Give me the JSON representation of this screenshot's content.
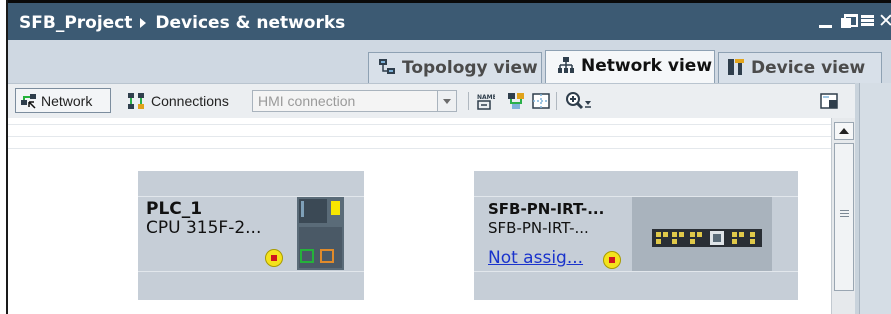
{
  "window": {
    "title_project": "SFB_Project",
    "title_section": "Devices & networks"
  },
  "tabs": [
    {
      "label": "Topology view",
      "icon": "topology-icon",
      "active": false
    },
    {
      "label": "Network view",
      "icon": "network-view-icon",
      "active": true
    },
    {
      "label": "Device view",
      "icon": "device-view-icon",
      "active": false
    }
  ],
  "toolbar": {
    "network_label": "Network",
    "connections_label": "Connections",
    "connection_type_selected": "HMI connection",
    "connection_type_placeholder": "HMI connection"
  },
  "devices": [
    {
      "name": "PLC_1",
      "type": "CPU 315F-2...",
      "fault": true
    },
    {
      "name": "SFB-PN-IRT-...",
      "type": "SFB-PN-IRT-...",
      "assignment_link": "Not assig...",
      "fault": true
    }
  ],
  "colors": {
    "title_bar": "#3c5a73",
    "device_box": "#c6ced7",
    "port_green": "#25b23a",
    "port_orange": "#e08a2a",
    "fault_yellow": "#f4e21c",
    "fault_red": "#d0151e",
    "link_blue": "#1a33cc"
  }
}
